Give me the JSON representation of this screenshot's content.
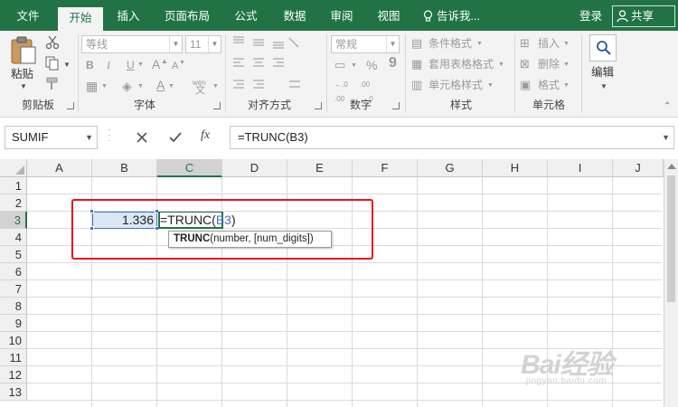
{
  "menubar": {
    "tabs": [
      {
        "label": "文件",
        "active": false
      },
      {
        "label": "开始",
        "active": true
      },
      {
        "label": "插入",
        "active": false
      },
      {
        "label": "页面布局",
        "active": false
      },
      {
        "label": "公式",
        "active": false
      },
      {
        "label": "数据",
        "active": false
      },
      {
        "label": "审阅",
        "active": false
      },
      {
        "label": "视图",
        "active": false
      }
    ],
    "tell_me": "告诉我...",
    "login": "登录",
    "share": "共享"
  },
  "ribbon": {
    "clipboard": {
      "paste_label": "粘贴",
      "group_label": "剪贴板"
    },
    "font": {
      "font_name": "等线",
      "font_size": "11",
      "bold": "B",
      "italic": "I",
      "underline": "U",
      "grow": "A",
      "shrink": "A",
      "font_color": "A",
      "phonetic": "wén",
      "group_label": "字体"
    },
    "alignment": {
      "group_label": "对齐方式"
    },
    "number": {
      "format": "常规",
      "percent": "%",
      "comma": "9",
      "group_label": "数字"
    },
    "styles": {
      "conditional": "条件格式",
      "table_format": "套用表格格式",
      "cell_styles": "单元格样式",
      "group_label": "样式"
    },
    "cells": {
      "insert": "插入",
      "delete": "删除",
      "format": "格式",
      "group_label": "单元格"
    },
    "editing": {
      "label": "编辑"
    }
  },
  "formula_bar": {
    "name_box": "SUMIF",
    "fx": "fx",
    "formula": "=TRUNC(B3)"
  },
  "grid": {
    "columns": [
      "A",
      "B",
      "C",
      "D",
      "E",
      "F",
      "G",
      "H",
      "I",
      "J"
    ],
    "rows": [
      "1",
      "2",
      "3",
      "4",
      "5",
      "6",
      "7",
      "8",
      "9",
      "10",
      "11",
      "12",
      "13"
    ],
    "active_column": "C",
    "active_row": "3",
    "cells": {
      "B3": "1.336",
      "C3": {
        "prefix": "=TRUNC(",
        "ref": "B3",
        "suffix": ")"
      }
    }
  },
  "tooltip": {
    "func": "TRUNC",
    "args": "(number, [num_digits])"
  },
  "watermark": {
    "brand": "Bai经验",
    "url": "jingyan.baidu.com"
  },
  "colors": {
    "excel_green": "#217346",
    "selection_blue": "#4472c4",
    "highlight_red": "#e8141b"
  }
}
